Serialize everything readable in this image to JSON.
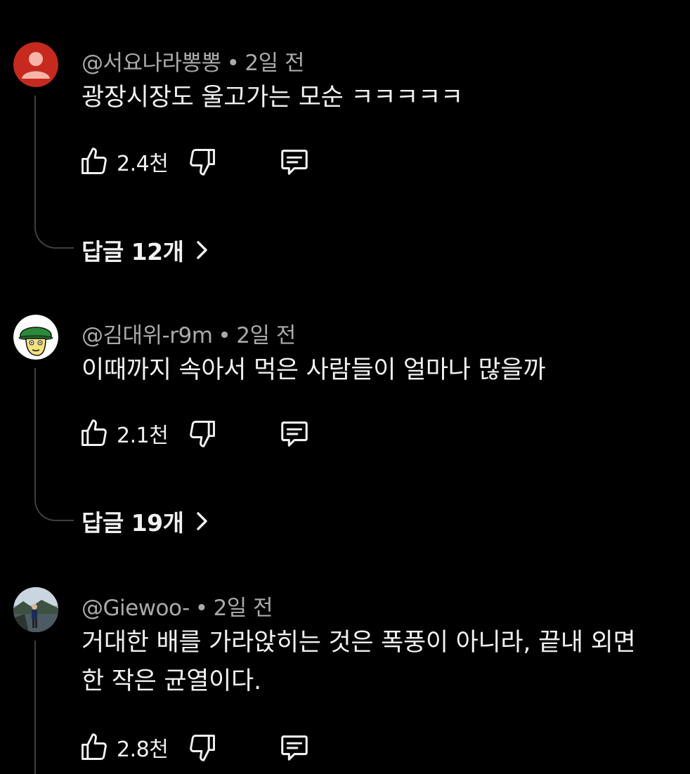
{
  "comments": [
    {
      "author": "@서요나라뽕뽕",
      "separator": "•",
      "time": "2일 전",
      "text": "광장시장도 울고가는 모순 ㅋㅋㅋㅋㅋ",
      "likes": "2.4천",
      "replies_label": "답글 12개",
      "avatar_color": "#c62a1f"
    },
    {
      "author": "@김대위-r9m",
      "separator": "•",
      "time": "2일 전",
      "text": "이때까지 속아서 먹은 사람들이 얼마나 많을까",
      "likes": "2.1천",
      "replies_label": "답글 19개",
      "avatar_color": "#ffffff"
    },
    {
      "author": "@Giewoo-",
      "separator": "•",
      "time": "2일 전",
      "text": "거대한 배를 가라앉히는 것은 폭풍이 아니라, 끝내 외면한 작은 균열이다.",
      "likes": "2.8천",
      "avatar_color": "#6b7a86"
    }
  ],
  "icons": {
    "like": "thumbs-up-icon",
    "dislike": "thumbs-down-icon",
    "reply": "comment-icon",
    "chevron": "chevron-right-icon"
  }
}
